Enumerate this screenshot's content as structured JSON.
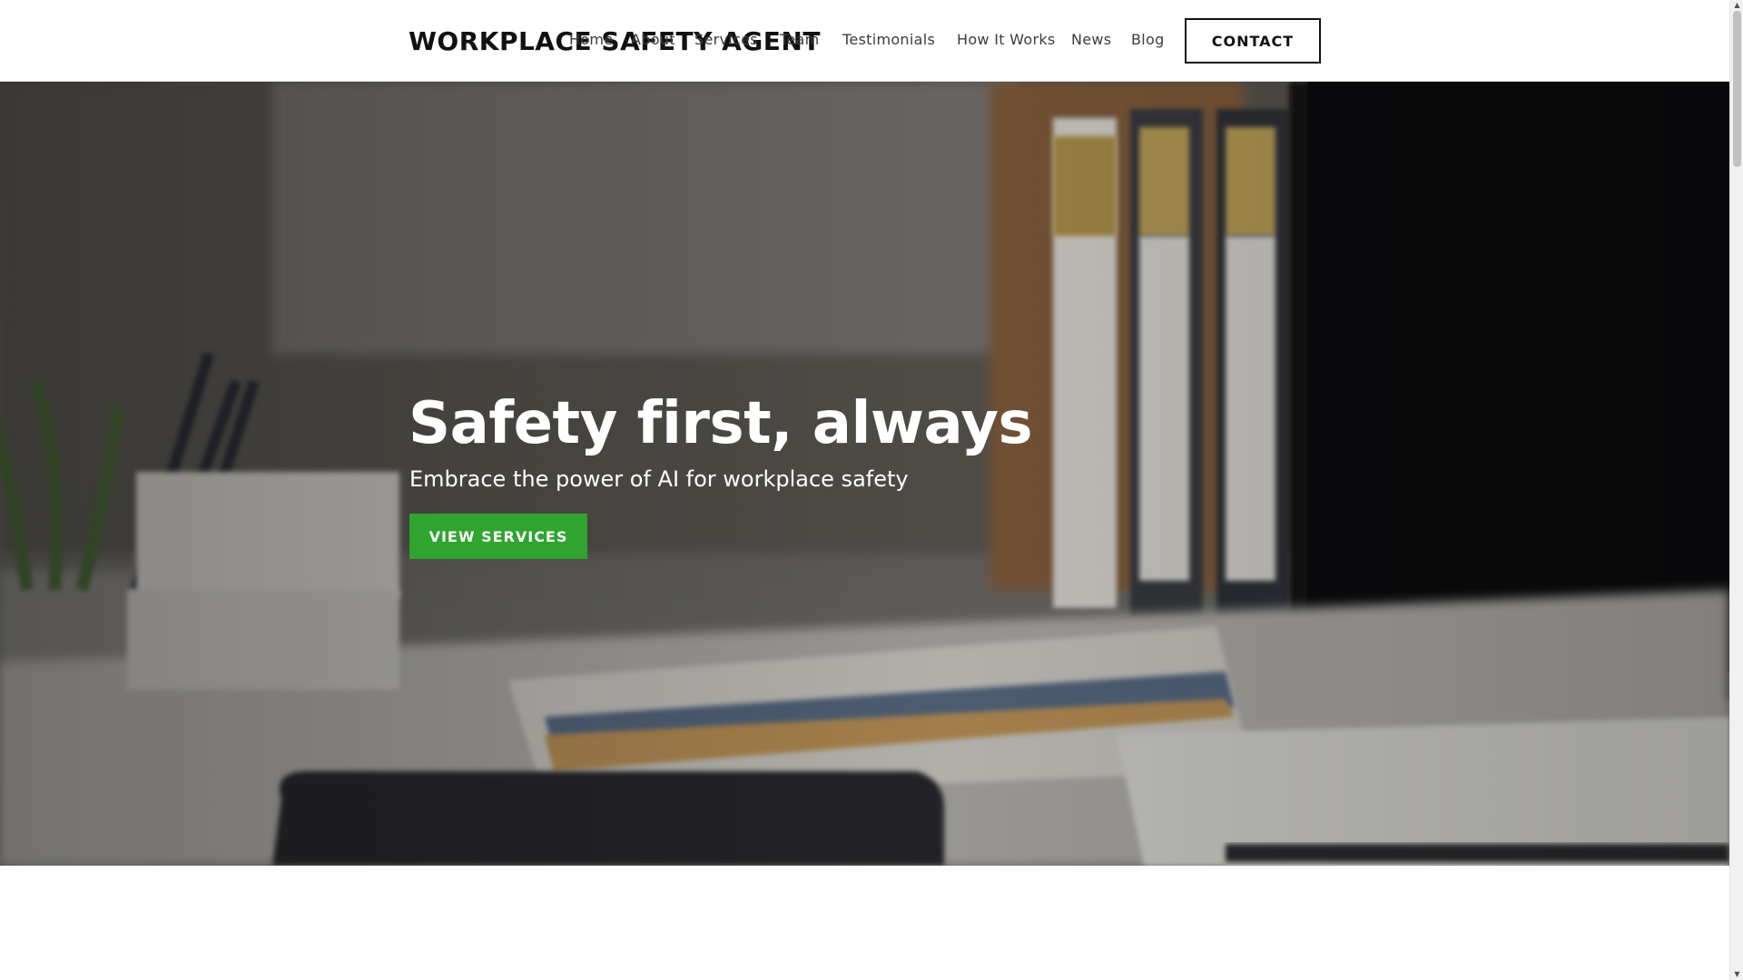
{
  "header": {
    "brand": "WORKPLACE SAFETY AGENT",
    "nav": [
      {
        "label": "Home"
      },
      {
        "label": "About"
      },
      {
        "label": "Services"
      },
      {
        "label": "Team"
      },
      {
        "label": "Testimonials"
      },
      {
        "label": "How It Works"
      },
      {
        "label": "News"
      },
      {
        "label": "Blog"
      }
    ],
    "contact_label": "CONTACT"
  },
  "hero": {
    "title": "Safety first, always",
    "subtitle": "Embrace the power of AI for workplace safety",
    "cta_label": "VIEW SERVICES",
    "cta_color": "#2fa52f"
  },
  "icons": {
    "scroll_up": "triangle-up",
    "scroll_down": "triangle-down"
  }
}
